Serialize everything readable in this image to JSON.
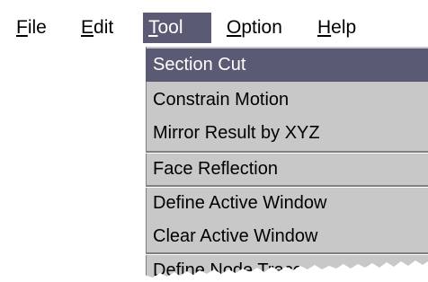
{
  "menubar": {
    "items": [
      {
        "mnemonic": "F",
        "rest": "ile"
      },
      {
        "mnemonic": "E",
        "rest": "dit"
      },
      {
        "mnemonic": "T",
        "rest": "ool"
      },
      {
        "mnemonic": "O",
        "rest": "ption"
      },
      {
        "mnemonic": "H",
        "rest": "elp"
      }
    ],
    "active_index": 2
  },
  "dropdown": {
    "items": [
      {
        "label": "Section Cut",
        "selected": true
      },
      {
        "label": "Constrain Motion"
      },
      {
        "label": "Mirror Result by XYZ"
      },
      {
        "label": "Face Reflection"
      },
      {
        "label": "Define Active Window"
      },
      {
        "label": "Clear Active Window"
      },
      {
        "label": "Define Node Trace"
      }
    ]
  },
  "colors": {
    "highlight": "#5a5a74",
    "menu_background": "#c8c8c8"
  }
}
